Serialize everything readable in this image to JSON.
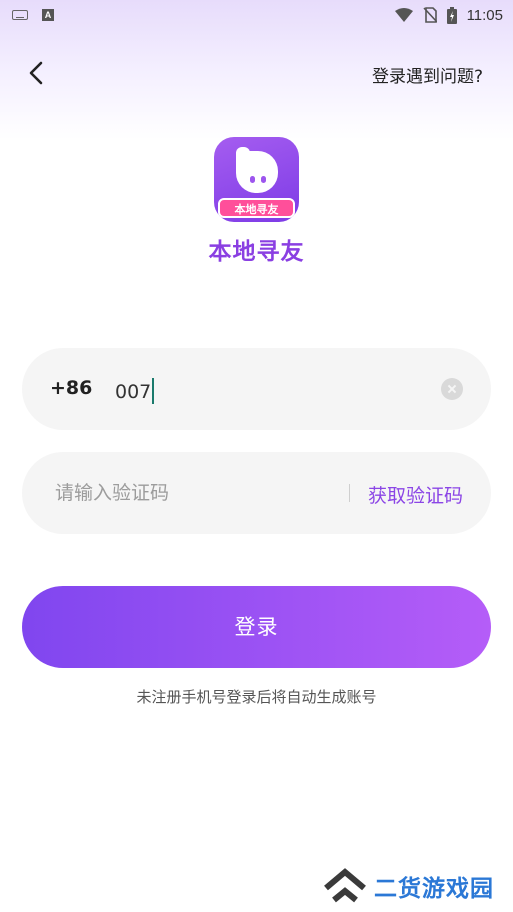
{
  "status_bar": {
    "time": "11:05",
    "a_badge": "A"
  },
  "header": {
    "help_label": "登录遇到问题?"
  },
  "brand": {
    "app_name": "本地寻友",
    "logo_banner": "本地寻友",
    "accent": "#8b45e6"
  },
  "phone": {
    "country_code": "+86",
    "value": "007"
  },
  "code": {
    "placeholder": "请输入验证码",
    "get_code_label": "获取验证码"
  },
  "login": {
    "label": "登录",
    "hint": "未注册手机号登录后将自动生成账号"
  },
  "watermark": {
    "text": "二货游戏园"
  }
}
